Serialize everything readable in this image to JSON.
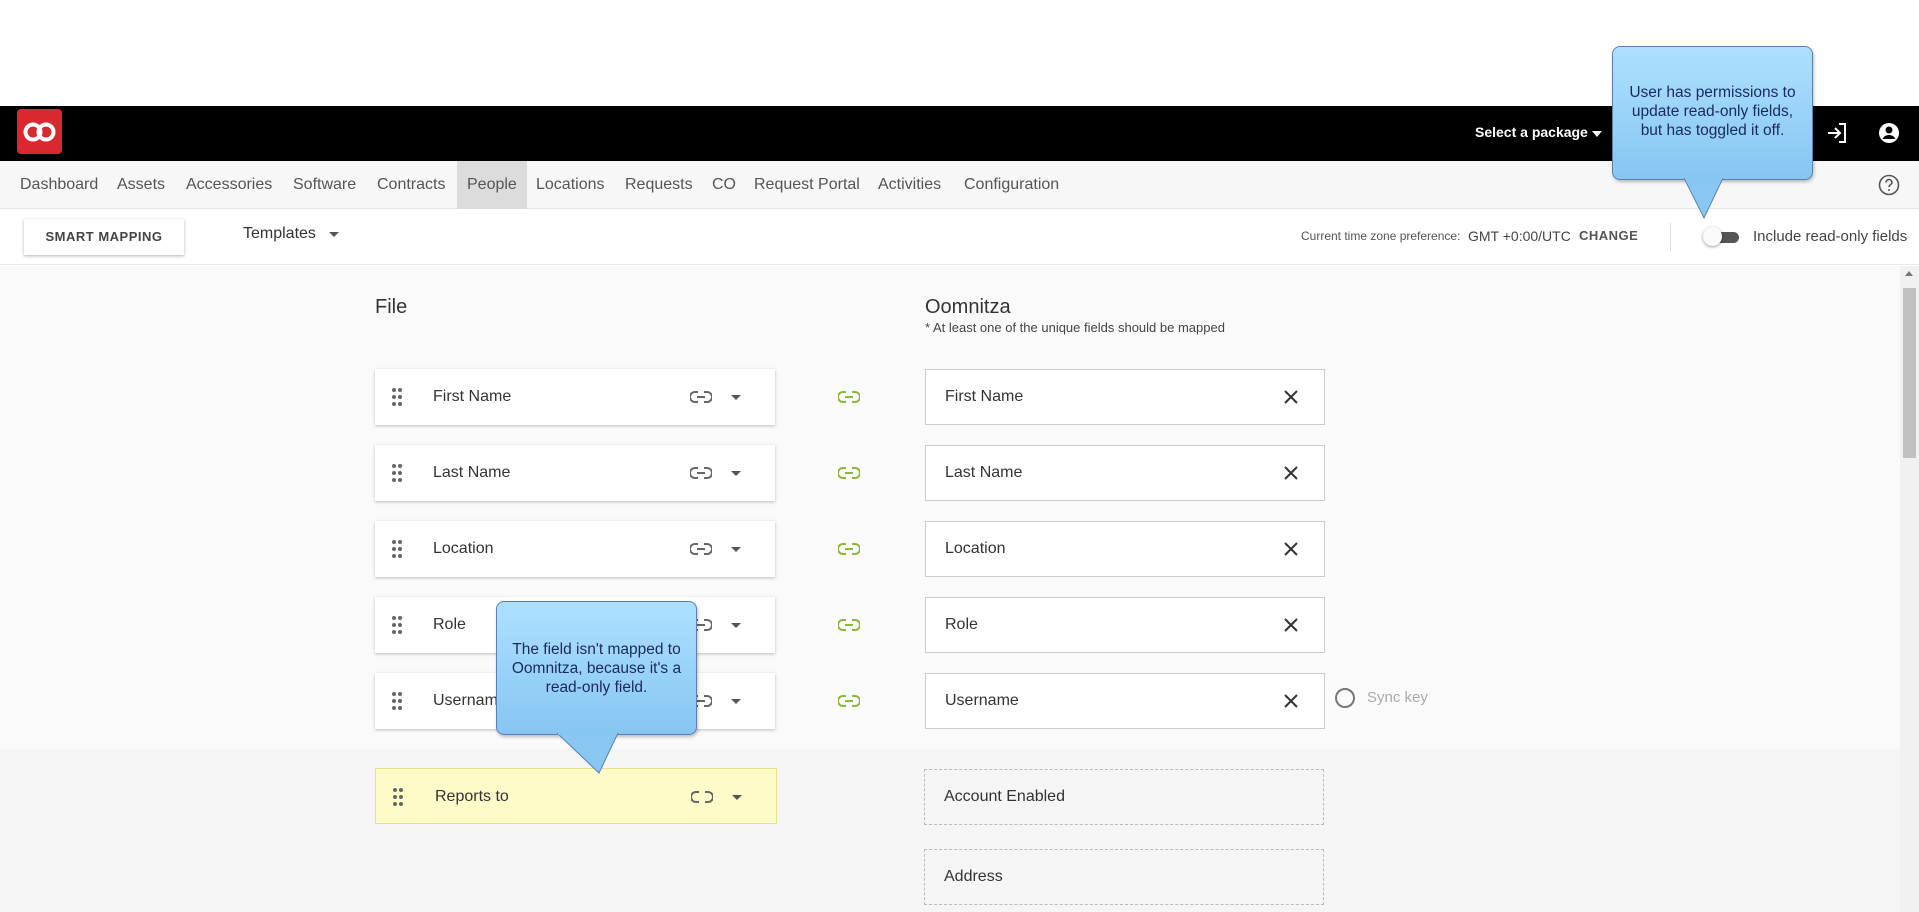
{
  "header": {
    "package_select": "Select a package"
  },
  "nav": {
    "items": [
      "Dashboard",
      "Assets",
      "Accessories",
      "Software",
      "Contracts",
      "People",
      "Locations",
      "Requests",
      "CO",
      "Request Portal",
      "Activities",
      "Configuration"
    ],
    "active": "People"
  },
  "toolbar": {
    "smart_mapping": "SMART MAPPING",
    "templates": "Templates",
    "tz_label": "Current time zone preference:",
    "tz_value": "GMT +0:00/UTC",
    "tz_change": "CHANGE",
    "readonly_label": "Include read-only fields",
    "readonly_enabled": false
  },
  "file_column": {
    "title": "File",
    "rows": [
      "First Name",
      "Last Name",
      "Location",
      "Role",
      "Username",
      "Reports to"
    ]
  },
  "omnitza_column": {
    "title": "Oomnitza",
    "subtitle": "* At least one of the unique fields should be mapped",
    "mapped": [
      "First Name",
      "Last Name",
      "Location",
      "Role",
      "Username"
    ],
    "unmapped": [
      "Account Enabled",
      "Address"
    ],
    "sync_key_label": "Sync key"
  },
  "callouts": {
    "readonly_toggle": "User has permissions to update read-only fields, but has toggled it off.",
    "unmapped_field": "The field isn't mapped to Oomnitza, because it's a read-only field."
  },
  "colors": {
    "brand": "#d9282f",
    "link_mapped": "#8cb63c",
    "highlight_row": "#fdfbc8"
  }
}
